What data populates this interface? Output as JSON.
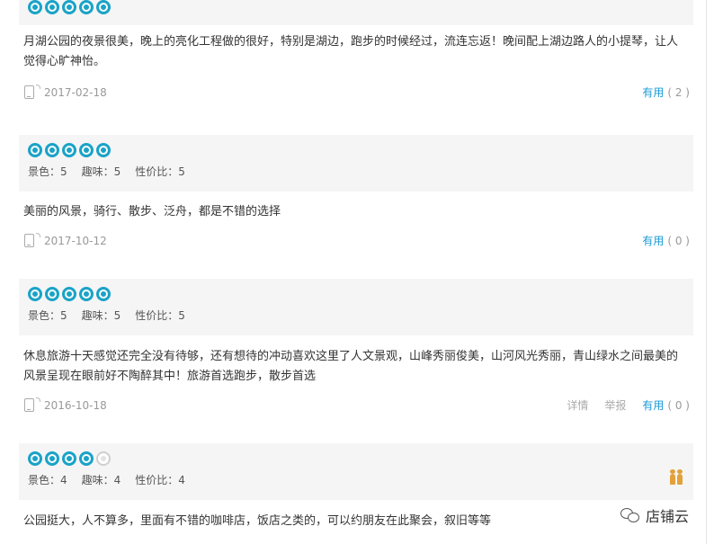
{
  "reviews": [
    {
      "rating": 5,
      "scores": [],
      "text": "月湖公园的夜景很美，晚上的亮化工程做的很好，特别是湖边，跑步的时候经过，流连忘返！晚间配上湖边路人的小提琴，让人觉得心旷神怡。",
      "date": "2017-02-18",
      "actions": [],
      "useful_label": "有用",
      "useful_count": "( 2 )"
    },
    {
      "rating": 5,
      "scores": [
        "景色：5",
        "趣味：5",
        "性价比：5"
      ],
      "text": "美丽的风景，骑行、散步、泛舟，都是不错的选择",
      "date": "2017-10-12",
      "actions": [],
      "useful_label": "有用",
      "useful_count": "( 0 )"
    },
    {
      "rating": 5,
      "scores": [
        "景色：5",
        "趣味：5",
        "性价比：5"
      ],
      "text": "休息旅游十天感觉还完全没有待够，还有想待的冲动喜欢这里了人文景观，山峰秀丽俊美，山河风光秀丽，青山绿水之间最美的风景呈现在眼前好不陶醉其中！旅游首选跑步，散步首选",
      "date": "2016-10-18",
      "actions": [
        "详情",
        "举报"
      ],
      "useful_label": "有用",
      "useful_count": "( 0 )"
    },
    {
      "rating": 4,
      "scores": [
        "景色：4",
        "趣味：4",
        "性价比：4"
      ],
      "text": "公园挺大，人不算多，里面有不错的咖啡店，饭店之类的，可以约朋友在此聚会，叙旧等等",
      "date": "",
      "actions": [],
      "useful_label": "",
      "useful_count": ""
    }
  ],
  "watermark": {
    "text": "店铺云"
  },
  "colors": {
    "accent": "#1aa3c7",
    "link": "#1a9ad6",
    "panel": "#f5f5f5",
    "badge": "#e2a13b"
  },
  "icons": {
    "phone": "phone-icon",
    "badge": "people-badge-icon",
    "watermark": "wechat-icon"
  }
}
